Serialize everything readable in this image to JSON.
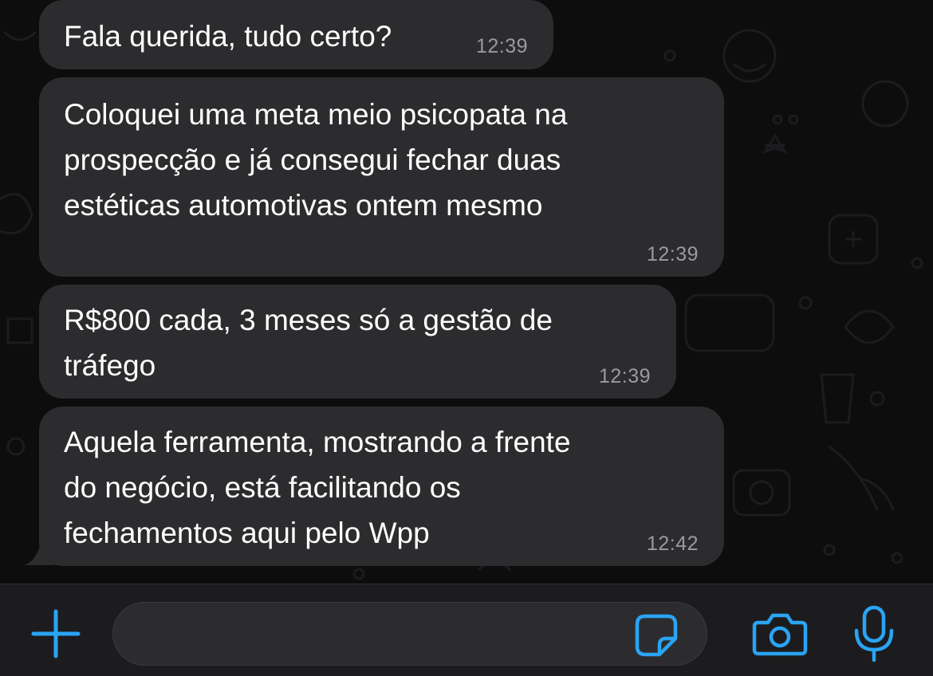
{
  "messages": [
    {
      "text": "Fala querida, tudo certo?",
      "time": "12:39"
    },
    {
      "text": "Coloquei uma meta meio psicopata na\nprospecção e já consegui fechar duas\nestéticas automotivas ontem mesmo",
      "time": "12:39"
    },
    {
      "text": "R$800 cada, 3 meses só a gestão de\ntráfego",
      "time": "12:39"
    },
    {
      "text": "Aquela ferramenta, mostrando a frente\ndo negócio, está facilitando os\nfechamentos aqui pelo Wpp",
      "time": "12:42"
    }
  ],
  "input_bar": {
    "message_value": "",
    "message_placeholder": "",
    "icons": {
      "attach": "plus-icon",
      "sticker": "sticker-icon",
      "camera": "camera-icon",
      "voice": "microphone-icon"
    }
  },
  "colors": {
    "accent": "#2aa4f4",
    "bubble": "#2c2c2e",
    "timestamp": "#9a9a9f"
  }
}
